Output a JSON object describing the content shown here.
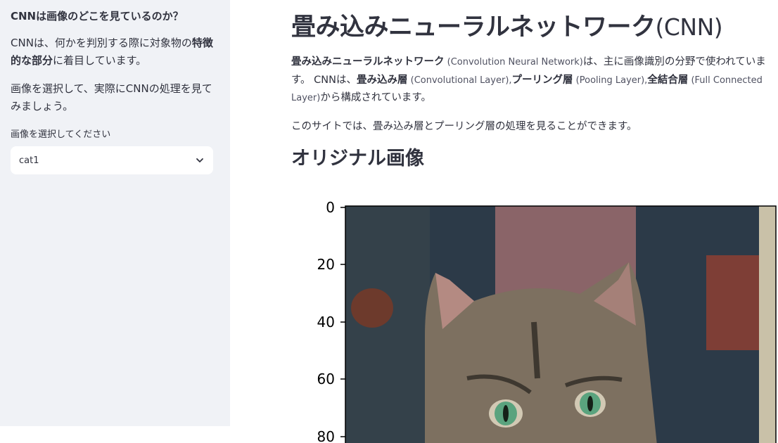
{
  "sidebar": {
    "heading": "CNNは画像のどこを見ているのか？",
    "para1_a": "CNNは、何かを判別する際に対象物の",
    "para1_bold": "特徴的な部分",
    "para1_b": "に着目しています。",
    "para2": "画像を選択して、実際にCNNの処理を見てみましょう。",
    "select_label": "画像を選択してください",
    "select_value": "cat1"
  },
  "main": {
    "title_jp": "畳み込みニューラルネットワーク",
    "title_en": "(CNN)",
    "intro": {
      "t1_bold": "畳み込みニューラルネットワーク",
      "t1_en": " (Convolution Neural Network)",
      "t2": "は、主に画像識別の分野で使われています。 CNNは、",
      "t3_bold": "畳み込み層",
      "t3_en": " (Convolutional Layer),",
      "t4_bold": "プーリング層",
      "t4_en": " (Pooling Layer),",
      "t5_bold": "全結合層",
      "t5_en": " (Full Connected Layer)",
      "t6": "から構成されています。"
    },
    "para2": "このサイトでは、畳み込み層とプーリング層の処理を見ることができます。",
    "section_heading": "オリジナル画像"
  },
  "figure": {
    "y_ticks": [
      "0",
      "20",
      "40",
      "60",
      "80"
    ],
    "colors": {
      "background_dark": "#2c3a48",
      "wall_pink": "#8a6468",
      "cat_fur": "#7d7060",
      "cat_dark": "#3e3830",
      "eye": "#5aa37e"
    }
  }
}
